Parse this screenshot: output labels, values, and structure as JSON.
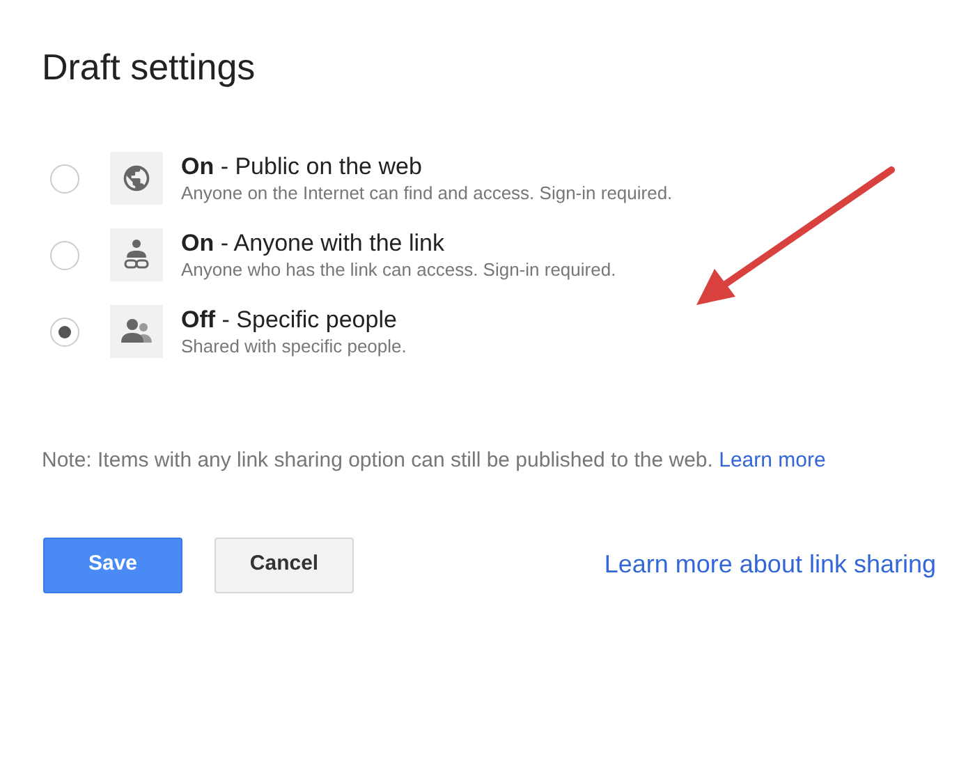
{
  "dialog": {
    "title": "Draft settings"
  },
  "options": [
    {
      "kind": "globe",
      "title": "**On** - Public on the web",
      "description": "Anyone on the Internet can find and access. Sign-in required.",
      "selected": false
    },
    {
      "kind": "link-person",
      "title": "**On** - Anyone with the link",
      "description": "Anyone who has the link can access. Sign-in required.",
      "selected": false
    },
    {
      "kind": "people",
      "title": "**Off** - Specific people",
      "description": "Shared with specific people.",
      "selected": true
    }
  ],
  "note": {
    "text": "Note: Items with any link sharing option can still be published to the web.",
    "link": "Learn more"
  },
  "buttons": [
    {
      "kind": "primary",
      "label": "Save"
    },
    {
      "kind": "secondary",
      "label": "Cancel"
    }
  ],
  "help_link": "Learn more about link sharing"
}
